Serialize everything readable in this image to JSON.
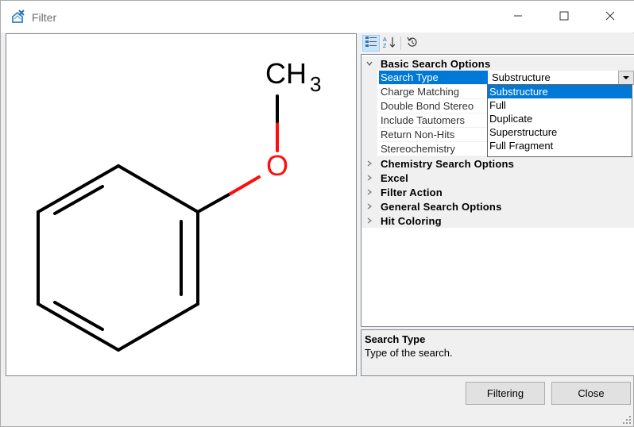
{
  "window": {
    "title": "Filter",
    "icons": {
      "app": "chemaxon-x-icon",
      "minimize": "minimize-icon",
      "maximize": "maximize-icon",
      "close": "close-icon"
    }
  },
  "structure": {
    "atom_labels": {
      "oxygen": "O",
      "methyl": "CH",
      "methyl_subscript": "3"
    },
    "colors": {
      "bond": "#000000",
      "oxygen": "#ff0d0d"
    }
  },
  "property_grid": {
    "toolbar_icons": [
      "categorized-view-icon",
      "sort-alphabetical-icon",
      "reset-icon"
    ],
    "categories": [
      {
        "label": "Basic Search Options",
        "expanded": true,
        "properties": [
          {
            "name": "Search Type",
            "value": "Substructure",
            "selected": true
          },
          {
            "name": "Charge Matching",
            "value": ""
          },
          {
            "name": "Double Bond Stereo",
            "value": ""
          },
          {
            "name": "Include Tautomers",
            "value": ""
          },
          {
            "name": "Return Non-Hits",
            "value": ""
          },
          {
            "name": "Stereochemistry",
            "value": ""
          }
        ]
      },
      {
        "label": "Chemistry Search Options",
        "expanded": false
      },
      {
        "label": "Excel",
        "expanded": false
      },
      {
        "label": "Filter Action",
        "expanded": false
      },
      {
        "label": "General Search Options",
        "expanded": false
      },
      {
        "label": "Hit Coloring",
        "expanded": false
      }
    ],
    "dropdown": {
      "options": [
        "Substructure",
        "Full",
        "Duplicate",
        "Superstructure",
        "Full Fragment"
      ],
      "selected": "Substructure"
    }
  },
  "help": {
    "title": "Search Type",
    "description": "Type of the search."
  },
  "buttons": {
    "filtering": "Filtering",
    "close": "Close"
  },
  "colors": {
    "selection": "#0078d7",
    "window_bg": "#f0f0f0"
  }
}
